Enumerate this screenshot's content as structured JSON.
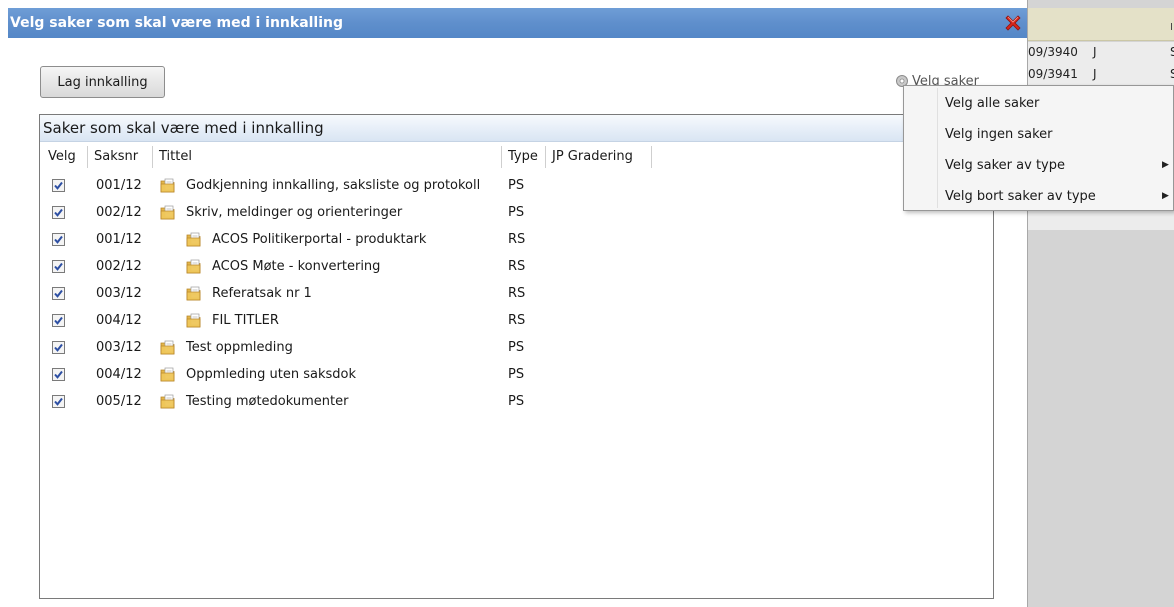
{
  "dialog": {
    "title": "Velg saker som skal være med i innkalling",
    "lag_innkalling_label": "Lag innkalling",
    "velg_saker_label": "Velg saker"
  },
  "panel": {
    "header": "Saker som skal være med i innkalling",
    "columns": {
      "velg": "Velg",
      "saksnr": "Saksnr",
      "tittel": "Tittel",
      "type": "Type",
      "jp_gradering": "JP Gradering"
    },
    "rows": [
      {
        "checked": true,
        "saksnr": "001/12",
        "tittel": "Godkjenning innkalling, saksliste og protokoll",
        "type": "PS",
        "level": 0
      },
      {
        "checked": true,
        "saksnr": "002/12",
        "tittel": "Skriv, meldinger og orienteringer",
        "type": "PS",
        "level": 0
      },
      {
        "checked": true,
        "saksnr": "001/12",
        "tittel": "ACOS Politikerportal - produktark",
        "type": "RS",
        "level": 1
      },
      {
        "checked": true,
        "saksnr": "002/12",
        "tittel": "ACOS Møte - konvertering",
        "type": "RS",
        "level": 1
      },
      {
        "checked": true,
        "saksnr": "003/12",
        "tittel": "Referatsak nr 1",
        "type": "RS",
        "level": 1
      },
      {
        "checked": true,
        "saksnr": "004/12",
        "tittel": "FIL TITLER",
        "type": "RS",
        "level": 1
      },
      {
        "checked": true,
        "saksnr": "003/12",
        "tittel": "Test oppmleding",
        "type": "PS",
        "level": 0
      },
      {
        "checked": true,
        "saksnr": "004/12",
        "tittel": "Oppmleding uten saksdok",
        "type": "PS",
        "level": 0
      },
      {
        "checked": true,
        "saksnr": "005/12",
        "tittel": "Testing møtedokumenter",
        "type": "PS",
        "level": 0
      }
    ]
  },
  "menu": {
    "items": [
      {
        "label": "Velg alle saker",
        "submenu": false
      },
      {
        "label": "Velg ingen saker",
        "submenu": false
      },
      {
        "label": "Velg saker av type",
        "submenu": true
      },
      {
        "label": "Velg bort saker av type",
        "submenu": true
      }
    ]
  },
  "background": {
    "top_mark": "I",
    "rows": [
      {
        "c1": "09/3940",
        "c2": "J",
        "c3": "S"
      },
      {
        "c1": "09/3941",
        "c2": "J",
        "c3": "S"
      }
    ]
  },
  "icons": {
    "close": "close-icon",
    "settings": "gear-icon",
    "folder": "folder-document-icon",
    "submenu": "triangle-right-icon"
  },
  "colors": {
    "titlebar": "#5f8fcc",
    "close_red": "#d9261c",
    "background_app": "#d4d4d4",
    "background_band": "#e4e1c8",
    "checkbox_mark": "#2d4fa3"
  }
}
